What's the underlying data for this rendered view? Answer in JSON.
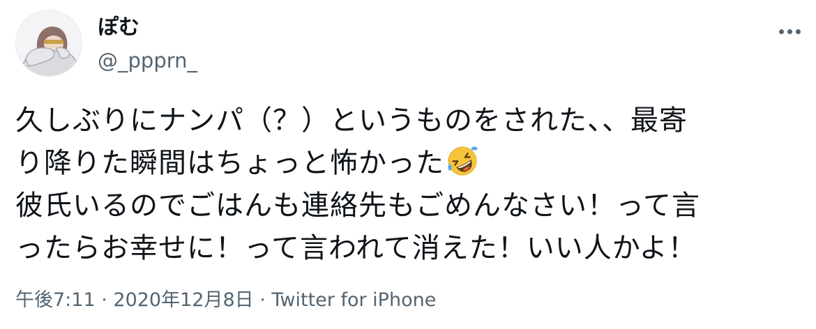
{
  "author": {
    "display_name": "ぽむ",
    "handle": "@_ppprn_",
    "avatar_icon": "user-avatar-icon"
  },
  "more_icon": "more-horizontal-icon",
  "tweet": {
    "lines": [
      "久しぶりにナンパ（？）というものをされた、、最寄",
      "り降りた瞬間はちょっと怖かった",
      "彼氏いるのでごはんも連絡先もごめんなさい！って言",
      "ったらお幸せに！って言われて消えた！いい人かよ！"
    ],
    "emoji_icon": "rolling-on-floor-laughing-emoji-icon"
  },
  "meta": {
    "time": "午後7:11",
    "separator1": " · ",
    "date": "2020年12月8日",
    "separator2": " · ",
    "source": "Twitter for iPhone"
  },
  "colors": {
    "text_primary": "#0f1419",
    "text_secondary": "#536471",
    "emoji_face": "#f7c53c",
    "emoji_tears": "#5aa7f0"
  }
}
